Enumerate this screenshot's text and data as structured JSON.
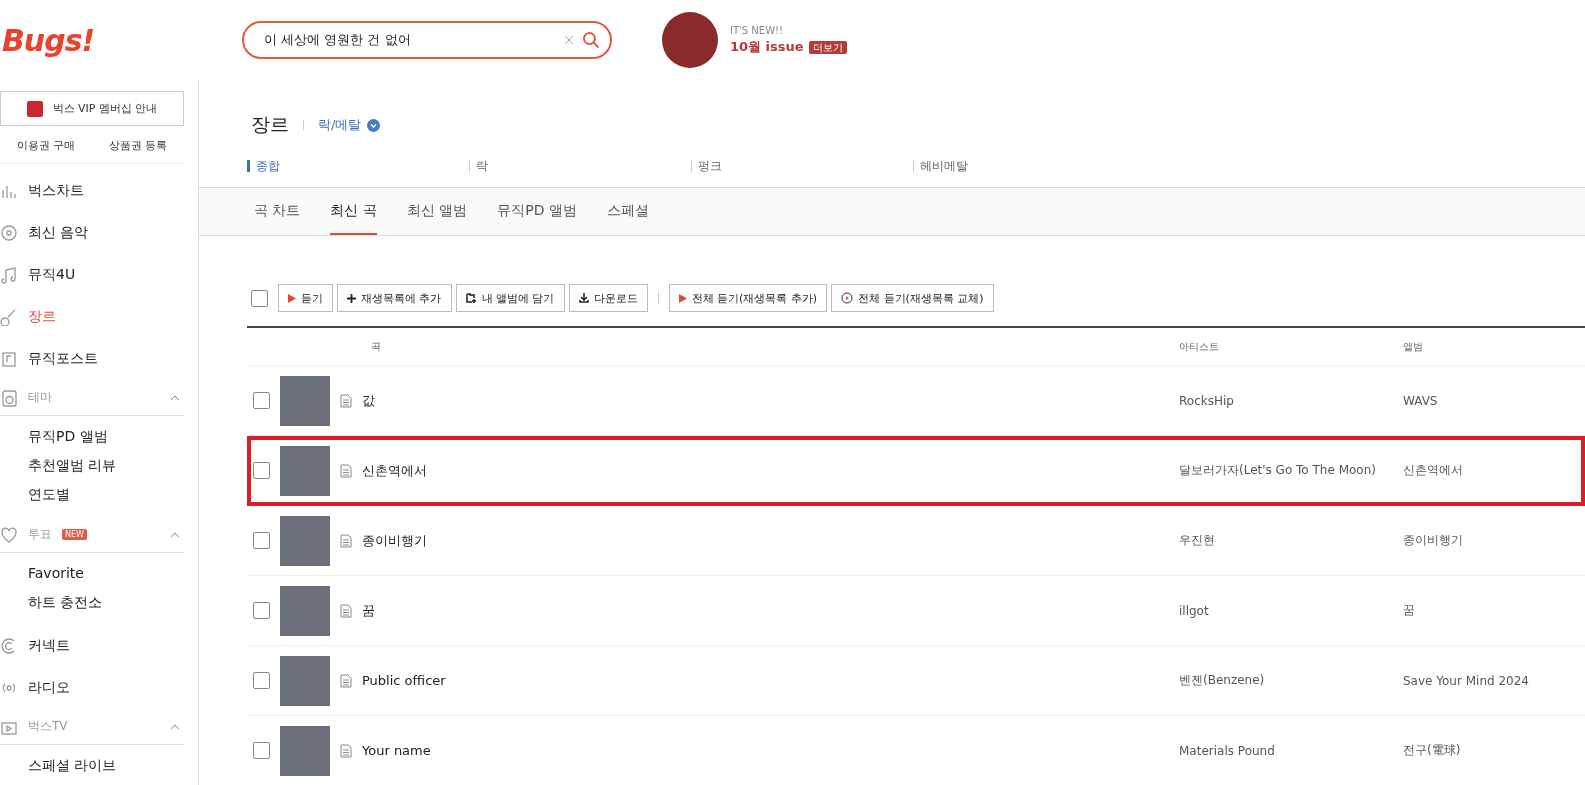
{
  "header": {
    "logo": "Bugs!",
    "search": {
      "value": "이 세상에 영원한 건 없어"
    },
    "promo": {
      "kicker": "IT'S NEW!!",
      "title": "10월 issue",
      "badge": "더보기"
    }
  },
  "sidebar": {
    "vip": "벅스 VIP 멤버십 안내",
    "links": [
      "이용권 구매",
      "상품권 등록"
    ],
    "items": [
      {
        "kind": "item",
        "label": "벅스차트",
        "selected": false
      },
      {
        "kind": "item",
        "label": "최신 음악",
        "selected": false
      },
      {
        "kind": "item",
        "label": "뮤직4U",
        "selected": false
      },
      {
        "kind": "item",
        "label": "장르",
        "selected": true
      },
      {
        "kind": "item",
        "label": "뮤직포스트",
        "selected": false
      },
      {
        "kind": "group",
        "label": "테마",
        "expanded": true,
        "children": [
          "뮤직PD 앨범",
          "추천앨범 리뷰",
          "연도별"
        ]
      },
      {
        "kind": "group",
        "label": "투표",
        "badge": "NEW",
        "expanded": true,
        "children": [
          "Favorite",
          "하트 충전소"
        ]
      },
      {
        "kind": "item",
        "label": "커넥트",
        "selected": false
      },
      {
        "kind": "item",
        "label": "라디오",
        "selected": false
      },
      {
        "kind": "group",
        "label": "벅스TV",
        "expanded": true,
        "children": [
          "스페셜 라이브"
        ]
      }
    ]
  },
  "page": {
    "title": "장르",
    "genre": "락/메탈",
    "subgenres": [
      {
        "label": "종합",
        "selected": true
      },
      {
        "label": "락",
        "selected": false
      },
      {
        "label": "펑크",
        "selected": false
      },
      {
        "label": "헤비메탈",
        "selected": false
      }
    ],
    "tabs": [
      {
        "label": "곡 차트",
        "selected": false
      },
      {
        "label": "최신 곡",
        "selected": true
      },
      {
        "label": "최신 앨범",
        "selected": false
      },
      {
        "label": "뮤직PD 앨범",
        "selected": false
      },
      {
        "label": "스페셜",
        "selected": false
      }
    ],
    "select_all": {
      "checked": false
    },
    "toolbar": [
      [
        {
          "kind": "play",
          "label": "듣기"
        },
        {
          "kind": "plus",
          "label": "재생목록에 추가"
        },
        {
          "kind": "album",
          "label": "내 앨범에 담기"
        },
        {
          "kind": "download",
          "label": "다운로드"
        }
      ],
      [
        {
          "kind": "play",
          "label": "전체 듣기(재생목록 추가)"
        },
        {
          "kind": "replace",
          "label": "전체 듣기(재생목록 교체)"
        }
      ]
    ],
    "table": {
      "columns": [
        "곡",
        "아티스트",
        "앨범"
      ],
      "rows": [
        {
          "title": "값",
          "artist": "RocksHip",
          "album": "WAVS",
          "checked": false,
          "highlighted": false
        },
        {
          "title": "신촌역에서",
          "artist": "달보러가자(Let's Go To The Moon)",
          "album": "신촌역에서",
          "checked": false,
          "highlighted": true
        },
        {
          "title": "종이비행기",
          "artist": "우진현",
          "album": "종이비행기",
          "checked": false,
          "highlighted": false
        },
        {
          "title": "꿈",
          "artist": "illgot",
          "album": "꿈",
          "checked": false,
          "highlighted": false
        },
        {
          "title": "Public officer",
          "artist": "벤젠(Benzene)",
          "album": "Save Your Mind 2024",
          "checked": false,
          "highlighted": false
        },
        {
          "title": "Your name",
          "artist": "Materials Pound",
          "album": "전구(電球)",
          "checked": false,
          "highlighted": false
        }
      ]
    }
  }
}
